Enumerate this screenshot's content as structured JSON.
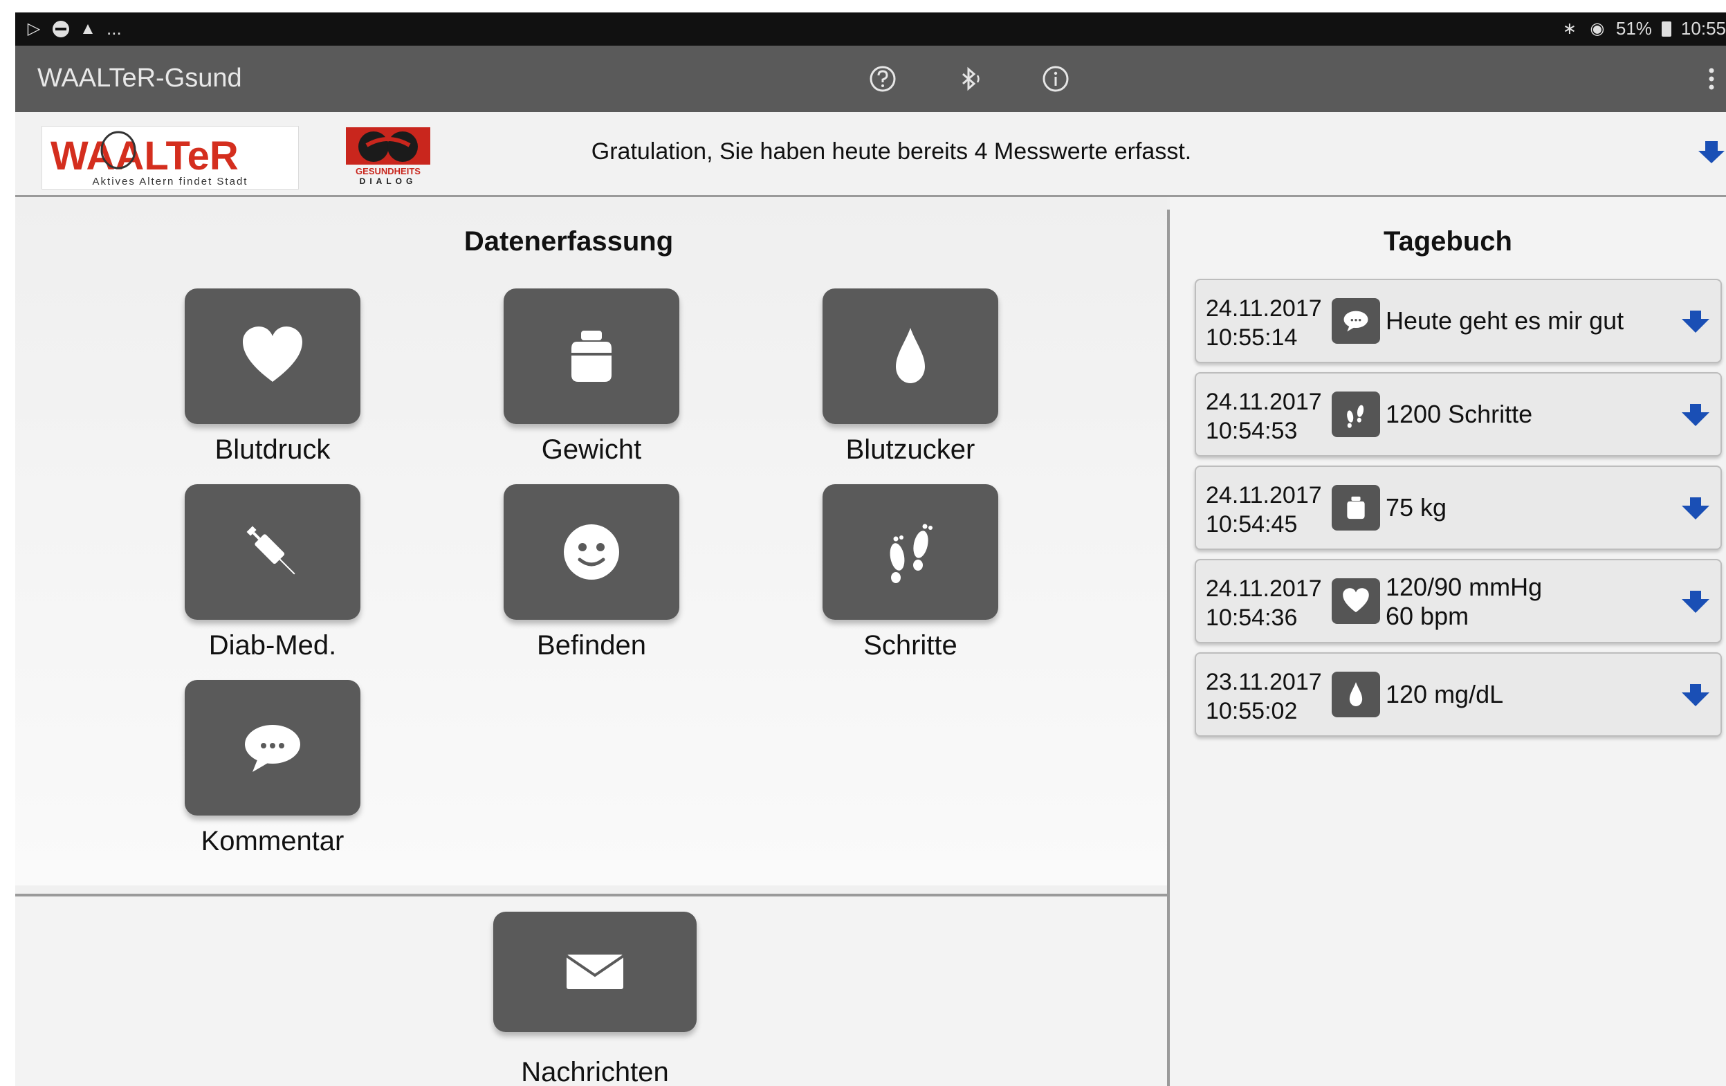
{
  "statusbar": {
    "battery": "51%",
    "time": "10:55",
    "more": "..."
  },
  "actionbar": {
    "title": "WAALTeR-Gsund",
    "icons": [
      "help-icon",
      "bluetooth-icon",
      "info-icon",
      "overflow-menu-icon"
    ]
  },
  "header": {
    "logo_waalter": {
      "name": "WAALTeR",
      "tagline": "Aktives Altern findet Stadt"
    },
    "logo_gd": {
      "line1": "GESUNDHEITS",
      "line2": "DIALOG"
    },
    "message": "Gratulation, Sie haben heute bereits 4 Messwerte erfasst."
  },
  "data_entry": {
    "title": "Datenerfassung",
    "tiles": [
      {
        "label": "Blutdruck",
        "icon": "heart-icon"
      },
      {
        "label": "Gewicht",
        "icon": "scale-weight-icon"
      },
      {
        "label": "Blutzucker",
        "icon": "drop-icon"
      },
      {
        "label": "Diab-Med.",
        "icon": "syringe-icon"
      },
      {
        "label": "Befinden",
        "icon": "smiley-icon"
      },
      {
        "label": "Schritte",
        "icon": "footprints-icon"
      },
      {
        "label": "Kommentar",
        "icon": "speech-bubble-icon"
      }
    ]
  },
  "messages": {
    "label": "Nachrichten",
    "icon": "envelope-icon"
  },
  "diary": {
    "title": "Tagebuch",
    "entries": [
      {
        "date": "24.11.2017",
        "time": "10:55:14",
        "icon": "speech-bubble-icon",
        "line1": "Heute geht es mir gut",
        "line2": ""
      },
      {
        "date": "24.11.2017",
        "time": "10:54:53",
        "icon": "footprints-icon",
        "line1": "1200 Schritte",
        "line2": ""
      },
      {
        "date": "24.11.2017",
        "time": "10:54:45",
        "icon": "scale-weight-icon",
        "line1": "75 kg",
        "line2": ""
      },
      {
        "date": "24.11.2017",
        "time": "10:54:36",
        "icon": "heart-icon",
        "line1": "120/90 mmHg",
        "line2": "60 bpm"
      },
      {
        "date": "23.11.2017",
        "time": "10:55:02",
        "icon": "drop-icon",
        "line1": "120 mg/dL",
        "line2": ""
      }
    ]
  },
  "colors": {
    "accent_arrow": "#1a4fb5",
    "tile": "#5a5a5a",
    "actionbar": "#5a5a5a",
    "logo_red": "#d42e1e"
  }
}
